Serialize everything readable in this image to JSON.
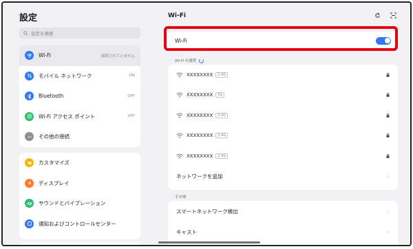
{
  "left": {
    "title": "設定",
    "search_placeholder": "設定を検索",
    "group1": [
      {
        "label": "Wi-Fi",
        "status": "接続されていません",
        "icon": "wifi-icon",
        "color": "#3478f6"
      },
      {
        "label": "モバイル ネットワーク",
        "status": "ON",
        "icon": "mobile-network-icon",
        "color": "#3478f6"
      },
      {
        "label": "Bluetooth",
        "status": "OFF",
        "icon": "bluetooth-icon",
        "color": "#3478f6"
      },
      {
        "label": "Wi-Fi アクセス ポイント",
        "status": "OFF",
        "icon": "hotspot-icon",
        "color": "#2fbf71"
      },
      {
        "label": "その他の接続",
        "status": "",
        "icon": "more-icon",
        "color": "#8e8e93"
      }
    ],
    "group2": [
      {
        "label": "カスタマイズ",
        "icon": "customize-icon",
        "color": "#f5b700"
      },
      {
        "label": "ディスプレイ",
        "icon": "display-icon",
        "color": "#ff7a2f"
      },
      {
        "label": "サウンドとバイブレーション",
        "icon": "sound-icon",
        "color": "#2fbf71"
      },
      {
        "label": "通知およびコントロールセンター",
        "icon": "notification-icon",
        "color": "#3478f6"
      }
    ]
  },
  "right": {
    "title": "Wi-Fi",
    "wifi_toggle_label": "Wi-Fi",
    "wifi_enabled": true,
    "select_label": "Wi-Fi の選択",
    "networks": [
      {
        "name": "XXXXXXXX",
        "band": "2.4G"
      },
      {
        "name": "XXXXXXXX",
        "band": "5G"
      },
      {
        "name": "XXXXXXXX",
        "band": "2.4G"
      },
      {
        "name": "XXXXXXXX",
        "band": "2.4G"
      },
      {
        "name": "XXXXXXXX",
        "band": "2.4G"
      }
    ],
    "add_network": "ネットワークを追加",
    "other_label": "その他",
    "other_items": [
      "スマートネットワーク検出",
      "キャスト"
    ]
  },
  "colors": {
    "accent": "#3478f6",
    "highlight": "#e50012"
  }
}
